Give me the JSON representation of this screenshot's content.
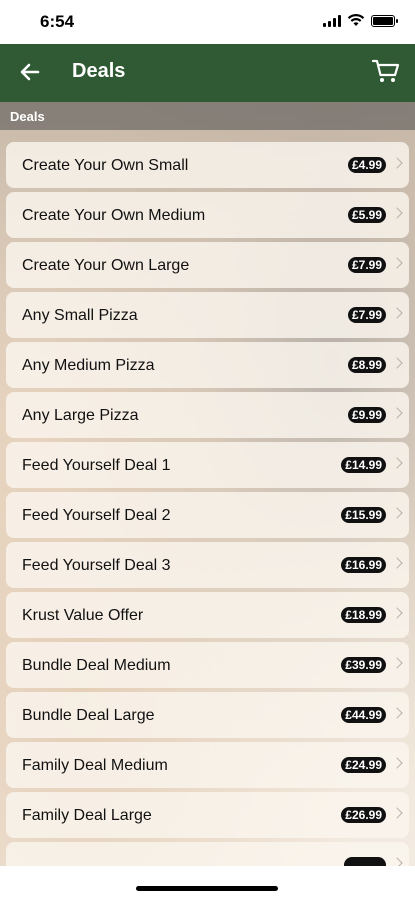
{
  "status_bar": {
    "time": "6:54"
  },
  "header": {
    "title": "Deals"
  },
  "section": {
    "title": "Deals"
  },
  "deals": [
    {
      "name": "Create Your Own Small",
      "price": "£4.99"
    },
    {
      "name": "Create Your Own Medium",
      "price": "£5.99"
    },
    {
      "name": "Create Your Own Large",
      "price": "£7.99"
    },
    {
      "name": "Any Small Pizza",
      "price": "£7.99"
    },
    {
      "name": "Any Medium Pizza",
      "price": "£8.99"
    },
    {
      "name": "Any Large Pizza",
      "price": "£9.99"
    },
    {
      "name": "Feed Yourself Deal 1",
      "price": "£14.99"
    },
    {
      "name": "Feed Yourself Deal 2",
      "price": "£15.99"
    },
    {
      "name": "Feed Yourself Deal 3",
      "price": "£16.99"
    },
    {
      "name": "Krust Value Offer",
      "price": "£18.99"
    },
    {
      "name": "Bundle Deal Medium",
      "price": "£39.99"
    },
    {
      "name": "Bundle Deal Large",
      "price": "£44.99"
    },
    {
      "name": "Family Deal Medium",
      "price": "£24.99"
    },
    {
      "name": "Family Deal Large",
      "price": "£26.99"
    }
  ],
  "icons": {
    "back": "arrow-left-icon",
    "cart": "cart-icon"
  },
  "colors": {
    "header": "#2f5a33",
    "badge": "#111111"
  }
}
